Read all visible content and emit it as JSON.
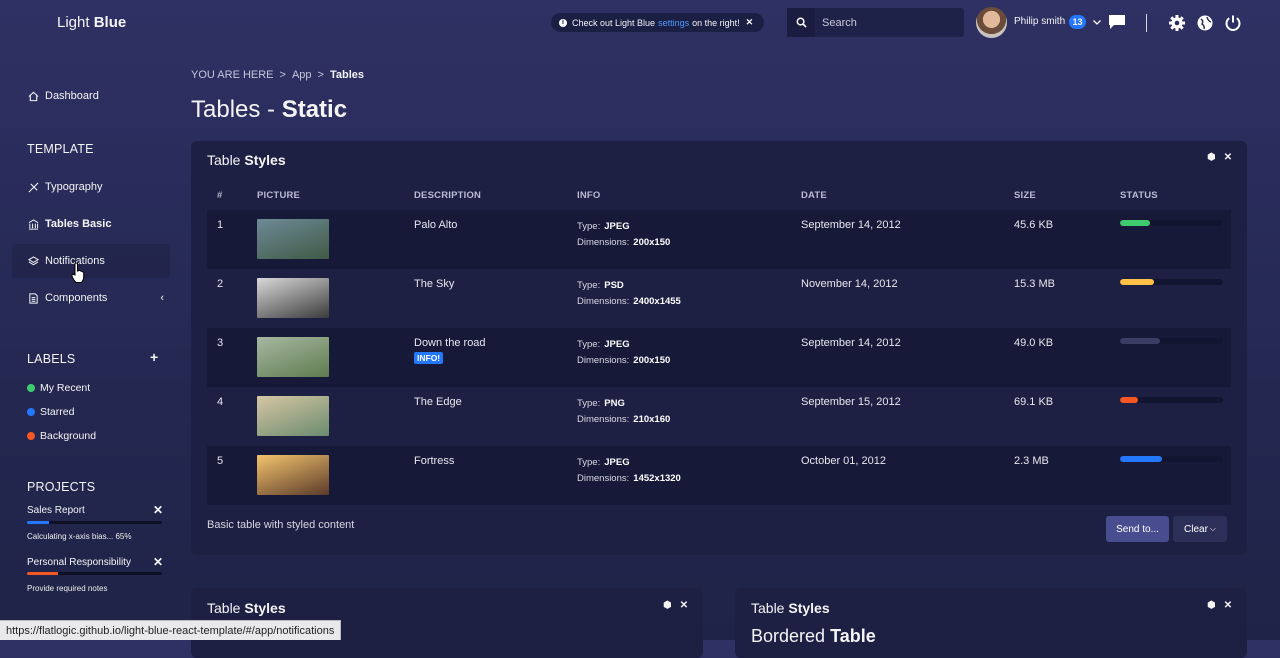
{
  "logo": {
    "light": "Light ",
    "bold": "Blue"
  },
  "header": {
    "notice": {
      "before": "Check out Light Blue",
      "link": "settings",
      "after": "on the right!"
    },
    "search": {
      "placeholder": "Search"
    },
    "user": {
      "name": "Philip smith",
      "badge": "13"
    }
  },
  "sidebar": {
    "dashboard": "Dashboard",
    "template_heading": "TEMPLATE",
    "items": [
      {
        "label": "Typography"
      },
      {
        "label": "Tables Basic"
      },
      {
        "label": "Notifications"
      },
      {
        "label": "Components"
      }
    ],
    "labels_heading": "LABELS",
    "labels": [
      {
        "label": "My Recent",
        "color": "#3ecd6e"
      },
      {
        "label": "Starred",
        "color": "#2477ff"
      },
      {
        "label": "Background",
        "color": "#f45722"
      }
    ],
    "projects_heading": "PROJECTS",
    "projects": [
      {
        "title": "Sales Report",
        "progress": 0.16,
        "color": "#2477ff",
        "note": "Calculating x-axis bias... 65%"
      },
      {
        "title": "Personal Responsibility",
        "progress": 0.23,
        "color": "#f45722",
        "note": "Provide required notes"
      }
    ]
  },
  "breadcrumb": {
    "prefix": "YOU ARE HERE",
    "sep": ">",
    "app": "App",
    "current": "Tables"
  },
  "page_title": {
    "light": "Tables - ",
    "bold": "Static"
  },
  "widget1": {
    "title_light": "Table ",
    "title_bold": "Styles",
    "columns": [
      "#",
      "PICTURE",
      "DESCRIPTION",
      "INFO",
      "DATE",
      "SIZE",
      "STATUS"
    ],
    "rows": [
      {
        "num": "1",
        "desc": "Palo Alto",
        "type": "JPEG",
        "dims": "200x150",
        "date": "September 14, 2012",
        "size": "45.6 KB",
        "status": 0.29,
        "status_color": "#3ecd6e",
        "thumb_a": "#6e8a97",
        "thumb_b": "#3f5a45",
        "label": ""
      },
      {
        "num": "2",
        "desc": "The Sky",
        "type": "PSD",
        "dims": "2400x1455",
        "date": "November 14, 2012",
        "size": "15.3 MB",
        "status": 0.33,
        "status_color": "#ffc247",
        "thumb_a": "#d9d9d9",
        "thumb_b": "#3b3b3b",
        "label": ""
      },
      {
        "num": "3",
        "desc": "Down the road",
        "type": "JPEG",
        "dims": "200x150",
        "date": "September 14, 2012",
        "size": "49.0 KB",
        "status": 0.39,
        "status_color": "#3a3e63",
        "thumb_a": "#a7b7a1",
        "thumb_b": "#5f7c4f",
        "label": "INFO!"
      },
      {
        "num": "4",
        "desc": "The Edge",
        "type": "PNG",
        "dims": "210x160",
        "date": "September 15, 2012",
        "size": "69.1 KB",
        "status": 0.17,
        "status_color": "#f45722",
        "thumb_a": "#d5c6a3",
        "thumb_b": "#6b8b6f",
        "label": ""
      },
      {
        "num": "5",
        "desc": "Fortress",
        "type": "JPEG",
        "dims": "1452x1320",
        "date": "October 01, 2012",
        "size": "2.3 MB",
        "status": 0.41,
        "status_color": "#2477ff",
        "thumb_a": "#f3c46d",
        "thumb_b": "#5b3a2a",
        "label": ""
      }
    ],
    "info_type_label": "Type:",
    "info_dims_label": "Dimensions:",
    "footer": "Basic table with styled content",
    "send_label": "Send to...",
    "clear_label": "Clear"
  },
  "widget2": {
    "title_light": "Table ",
    "title_bold": "Styles"
  },
  "widget3": {
    "title_light": "Table ",
    "title_bold": "Styles",
    "subtitle_light": "Bordered ",
    "subtitle_bold": "Table"
  },
  "status_url": "https://flatlogic.github.io/light-blue-react-template/#/app/notifications"
}
